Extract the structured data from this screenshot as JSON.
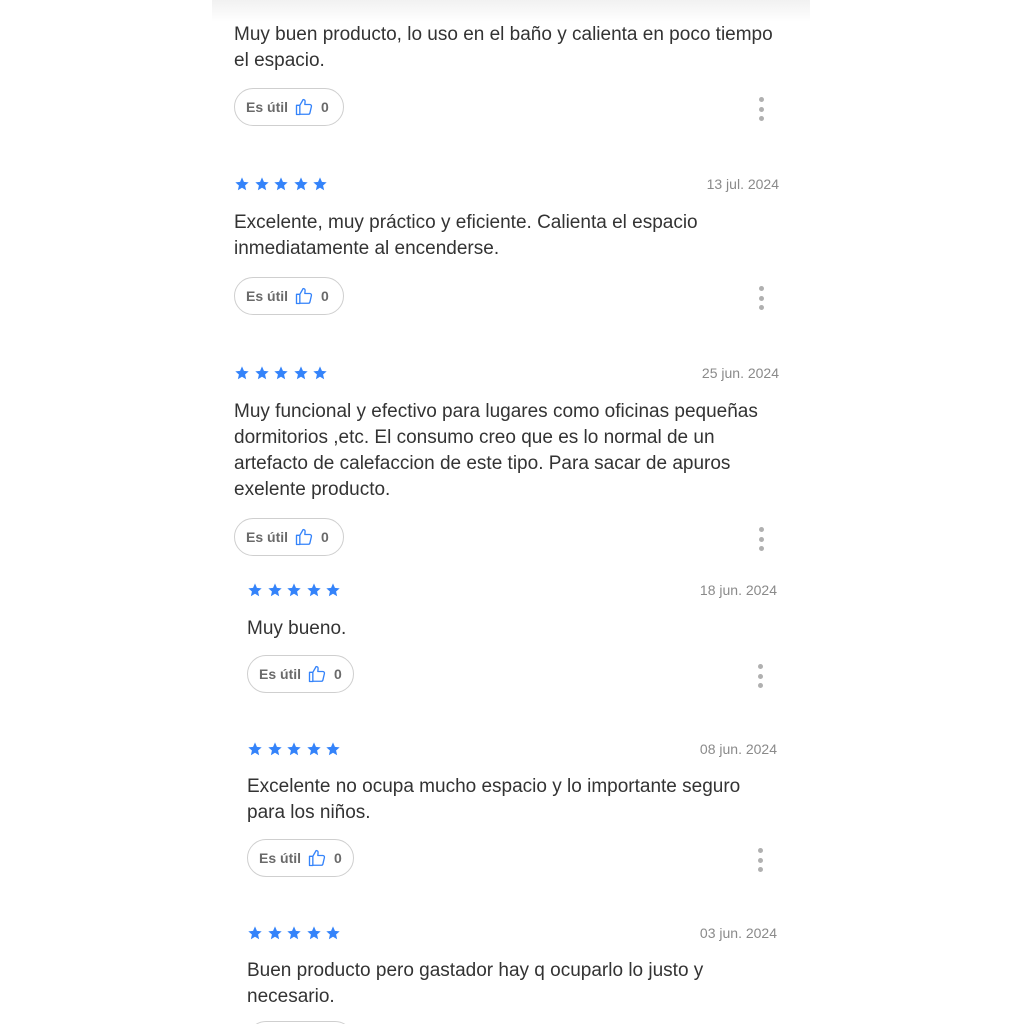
{
  "colors": {
    "star": "#3483fa",
    "thumb": "#3483fa",
    "date": "#8a8a8a",
    "text": "#333333"
  },
  "helpful_label": "Es útil",
  "reviews": [
    {
      "rating": 5,
      "date": "",
      "text": "Muy buen producto, lo uso en el baño y calienta en poco tiempo el espacio.",
      "helpful_count": "0"
    },
    {
      "rating": 5,
      "date": "13 jul. 2024",
      "text": "Excelente, muy práctico y eficiente. Calienta el espacio inmediatamente al encenderse.",
      "helpful_count": "0"
    },
    {
      "rating": 5,
      "date": "25 jun. 2024",
      "text": "Muy funcional y efectivo para lugares como oficinas pequeñas dormitorios ,etc. El consumo creo que es lo normal de un artefacto de calefaccion de este tipo. Para sacar de apuros exelente producto.",
      "helpful_count": "0"
    },
    {
      "rating": 5,
      "date": "18 jun. 2024",
      "text": "Muy bueno.",
      "helpful_count": "0"
    },
    {
      "rating": 5,
      "date": "08 jun. 2024",
      "text": "Excelente no ocupa mucho espacio y lo importante seguro para los niños.",
      "helpful_count": "0"
    },
    {
      "rating": 5,
      "date": "03 jun. 2024",
      "text": "Buen producto pero gastador hay q ocuparlo lo justo y necesario.",
      "helpful_count": ""
    }
  ]
}
